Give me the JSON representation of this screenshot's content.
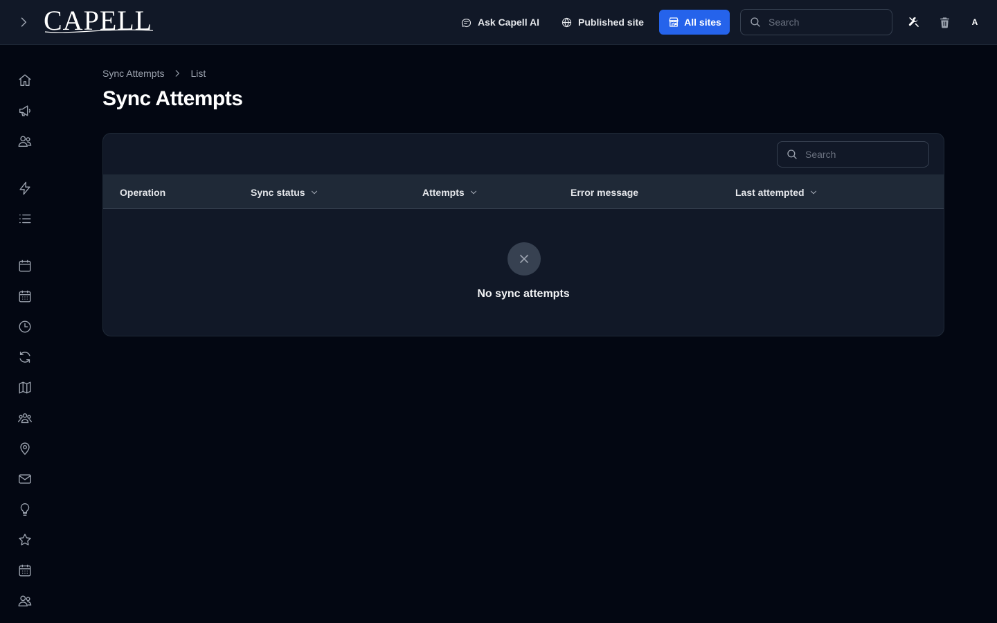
{
  "header": {
    "logo_text": "CAPELL",
    "ask_ai_label": "Ask Capell AI",
    "published_site_label": "Published site",
    "all_sites_label": "All sites",
    "search_placeholder": "Search",
    "avatar_initial": "A"
  },
  "icons": {
    "expand": "chevron-right-icon",
    "ask_ai": "chat-bubble-icon",
    "published_site": "globe-icon",
    "all_sites": "storefront-icon",
    "tools": "wrench-screwdriver-icon",
    "trash": "trash-icon"
  },
  "sidebar": {
    "items": [
      {
        "name": "home-icon"
      },
      {
        "name": "megaphone-icon"
      },
      {
        "name": "users-icon"
      },
      {
        "name": "bolt-icon"
      },
      {
        "name": "list-icon"
      },
      {
        "name": "calendar-icon"
      },
      {
        "name": "calendar-days-icon"
      },
      {
        "name": "clock-icon"
      },
      {
        "name": "refresh-icon"
      },
      {
        "name": "map-icon"
      },
      {
        "name": "user-group-icon"
      },
      {
        "name": "map-pin-icon"
      },
      {
        "name": "envelope-icon"
      },
      {
        "name": "light-bulb-icon"
      },
      {
        "name": "star-icon"
      },
      {
        "name": "calendar-days-icon"
      },
      {
        "name": "users-icon"
      }
    ]
  },
  "breadcrumb": {
    "parent": "Sync Attempts",
    "current": "List"
  },
  "page": {
    "title": "Sync Attempts"
  },
  "table": {
    "search_placeholder": "Search",
    "columns": [
      {
        "label": "Operation",
        "sortable": false
      },
      {
        "label": "Sync status",
        "sortable": true
      },
      {
        "label": "Attempts",
        "sortable": true
      },
      {
        "label": "Error message",
        "sortable": false
      },
      {
        "label": "Last attempted",
        "sortable": true
      }
    ],
    "rows": [],
    "empty_text": "No sync attempts"
  },
  "colors": {
    "background": "#030712",
    "surface": "#111827",
    "header_row": "#1f2937",
    "accent": "#2563eb",
    "muted_text": "#9ca3af"
  }
}
